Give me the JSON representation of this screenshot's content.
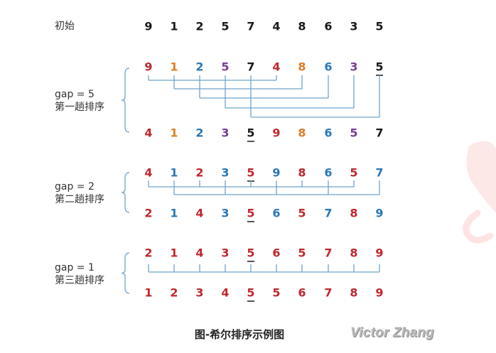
{
  "labels": {
    "initial": "初始",
    "pass1_gap": "gap = 5",
    "pass1_name": "第一趟排序",
    "pass2_gap": "gap = 2",
    "pass2_name": "第二趟排序",
    "pass3_gap": "gap = 1",
    "pass3_name": "第三趟排序"
  },
  "caption": "图-希尔排序示例图",
  "watermark": "Victor Zhang",
  "colors": {
    "black": "#1a1a1a",
    "red": "#c0272d",
    "orange": "#e07b27",
    "blue": "#2a78b5",
    "purple": "#7a3b9a",
    "line": "#6fa3c9",
    "brace": "#7fb0d6"
  },
  "rows": [
    {
      "id": "initial",
      "values": [
        "9",
        "1",
        "2",
        "5",
        "7",
        "4",
        "8",
        "6",
        "3",
        "5"
      ],
      "colors": [
        "black",
        "black",
        "black",
        "black",
        "black",
        "black",
        "black",
        "black",
        "black",
        "black"
      ],
      "underline": []
    },
    {
      "id": "pass1-before",
      "values": [
        "9",
        "1",
        "2",
        "5",
        "7",
        "4",
        "8",
        "6",
        "3",
        "5"
      ],
      "colors": [
        "red",
        "orange",
        "blue",
        "purple",
        "black",
        "red",
        "orange",
        "blue",
        "purple",
        "black"
      ],
      "underline": [
        9
      ]
    },
    {
      "id": "pass1-after",
      "values": [
        "4",
        "1",
        "2",
        "3",
        "5",
        "9",
        "8",
        "6",
        "5",
        "7"
      ],
      "colors": [
        "red",
        "orange",
        "blue",
        "purple",
        "black",
        "red",
        "orange",
        "blue",
        "purple",
        "black"
      ],
      "underline": [
        4
      ]
    },
    {
      "id": "pass2-before",
      "values": [
        "4",
        "1",
        "2",
        "3",
        "5",
        "9",
        "8",
        "6",
        "5",
        "7"
      ],
      "colors": [
        "red",
        "blue",
        "red",
        "blue",
        "red",
        "blue",
        "red",
        "blue",
        "red",
        "blue"
      ],
      "underline": [
        4
      ]
    },
    {
      "id": "pass2-after",
      "values": [
        "2",
        "1",
        "4",
        "3",
        "5",
        "6",
        "5",
        "7",
        "8",
        "9"
      ],
      "colors": [
        "red",
        "blue",
        "red",
        "blue",
        "red",
        "blue",
        "red",
        "blue",
        "red",
        "blue"
      ],
      "underline": [
        4
      ]
    },
    {
      "id": "pass3-before",
      "values": [
        "2",
        "1",
        "4",
        "3",
        "5",
        "6",
        "5",
        "7",
        "8",
        "9"
      ],
      "colors": [
        "red",
        "red",
        "red",
        "red",
        "red",
        "red",
        "red",
        "red",
        "red",
        "red"
      ],
      "underline": [
        4
      ]
    },
    {
      "id": "pass3-after",
      "values": [
        "1",
        "2",
        "3",
        "4",
        "5",
        "5",
        "6",
        "7",
        "8",
        "9"
      ],
      "colors": [
        "red",
        "red",
        "red",
        "red",
        "red",
        "red",
        "red",
        "red",
        "red",
        "red"
      ],
      "underline": [
        4
      ]
    }
  ]
}
